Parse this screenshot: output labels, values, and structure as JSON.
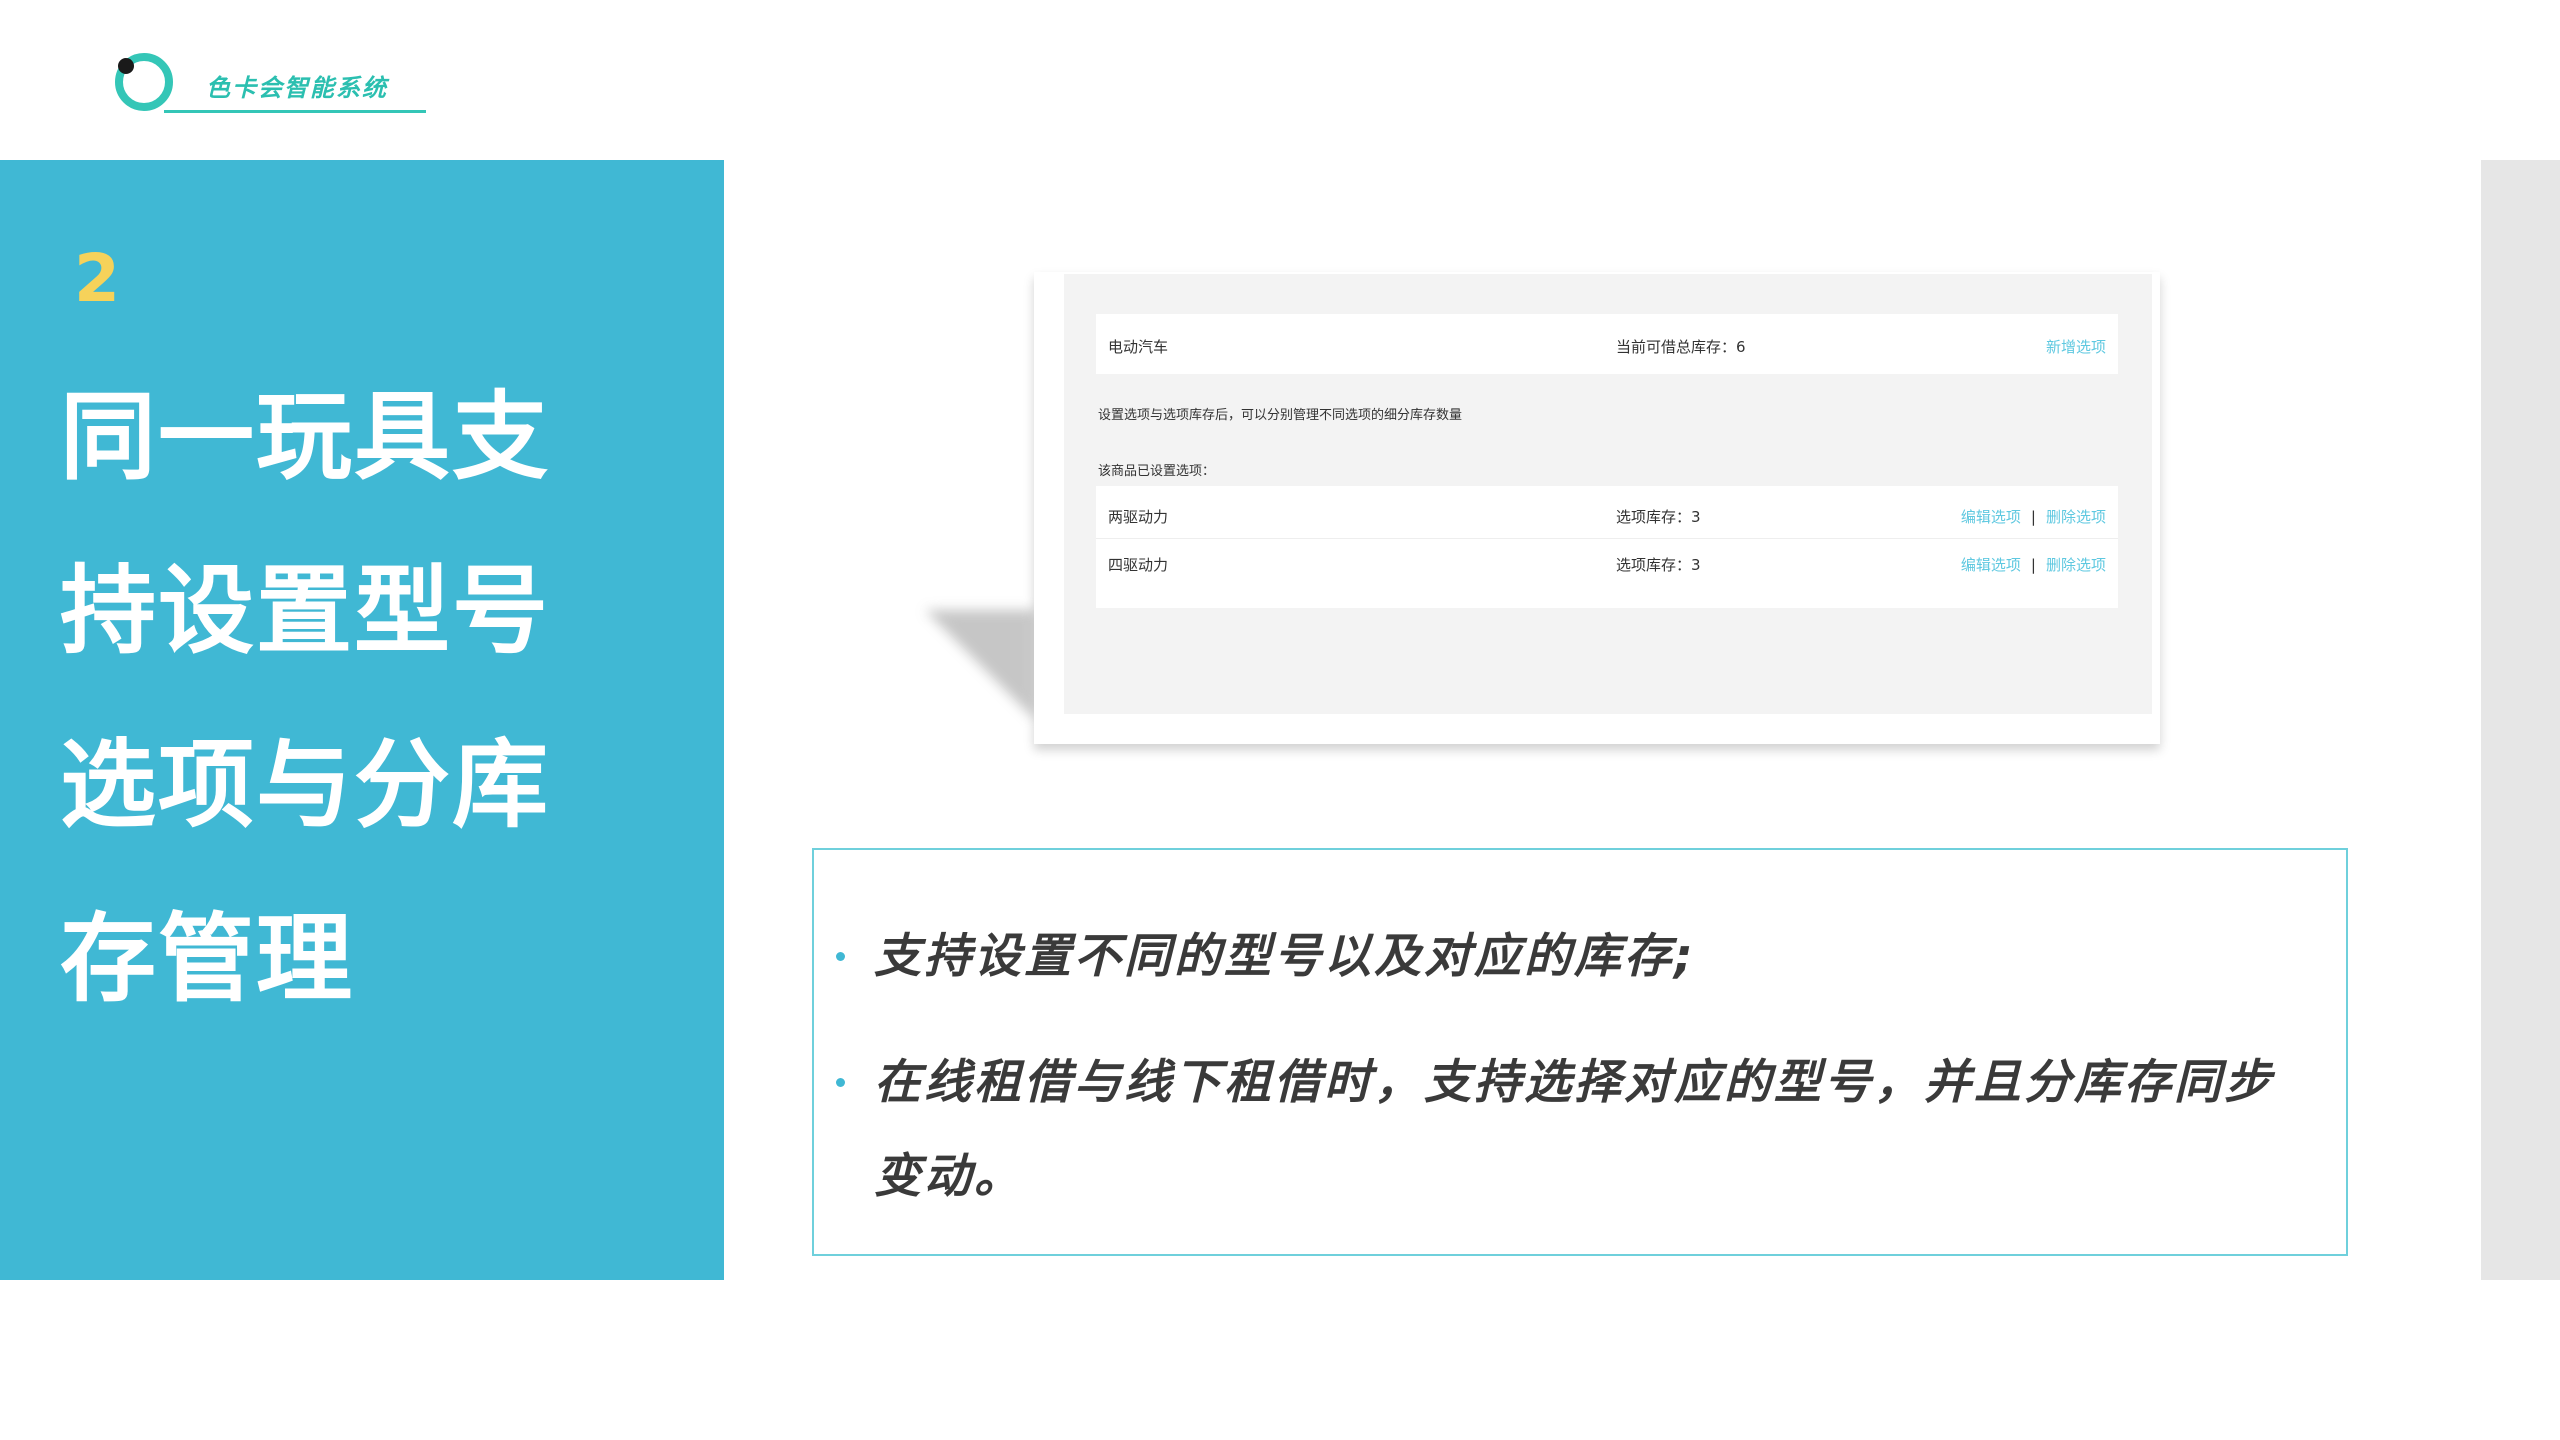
{
  "logo": {
    "text": "色卡会智能系统",
    "accent_color": "#2bbfb0"
  },
  "section": {
    "number": "2",
    "title": "同一玩具支持设置型号选项与分库存管理",
    "number_color": "#f6d25a",
    "panel_color": "#40b8d4"
  },
  "mockup": {
    "product_name": "电动汽车",
    "total_stock_label": "当前可借总库存：6",
    "add_option_label": "新增选项",
    "note": "设置选项与选项库存后，可以分别管理不同选项的细分库存数量",
    "options_heading": "该商品已设置选项：",
    "options": [
      {
        "name": "两驱动力",
        "stock_label": "选项库存：3",
        "edit_label": "编辑选项",
        "separator": "|",
        "delete_label": "删除选项"
      },
      {
        "name": "四驱动力",
        "stock_label": "选项库存：3",
        "edit_label": "编辑选项",
        "separator": "|",
        "delete_label": "删除选项"
      }
    ],
    "link_color": "#5ec8e0"
  },
  "description": {
    "bullets": [
      "支持设置不同的型号以及对应的库存;",
      "在线租借与线下租借时，支持选择对应的型号，并且分库存同步变动。"
    ],
    "border_color": "#6fd0dc"
  }
}
